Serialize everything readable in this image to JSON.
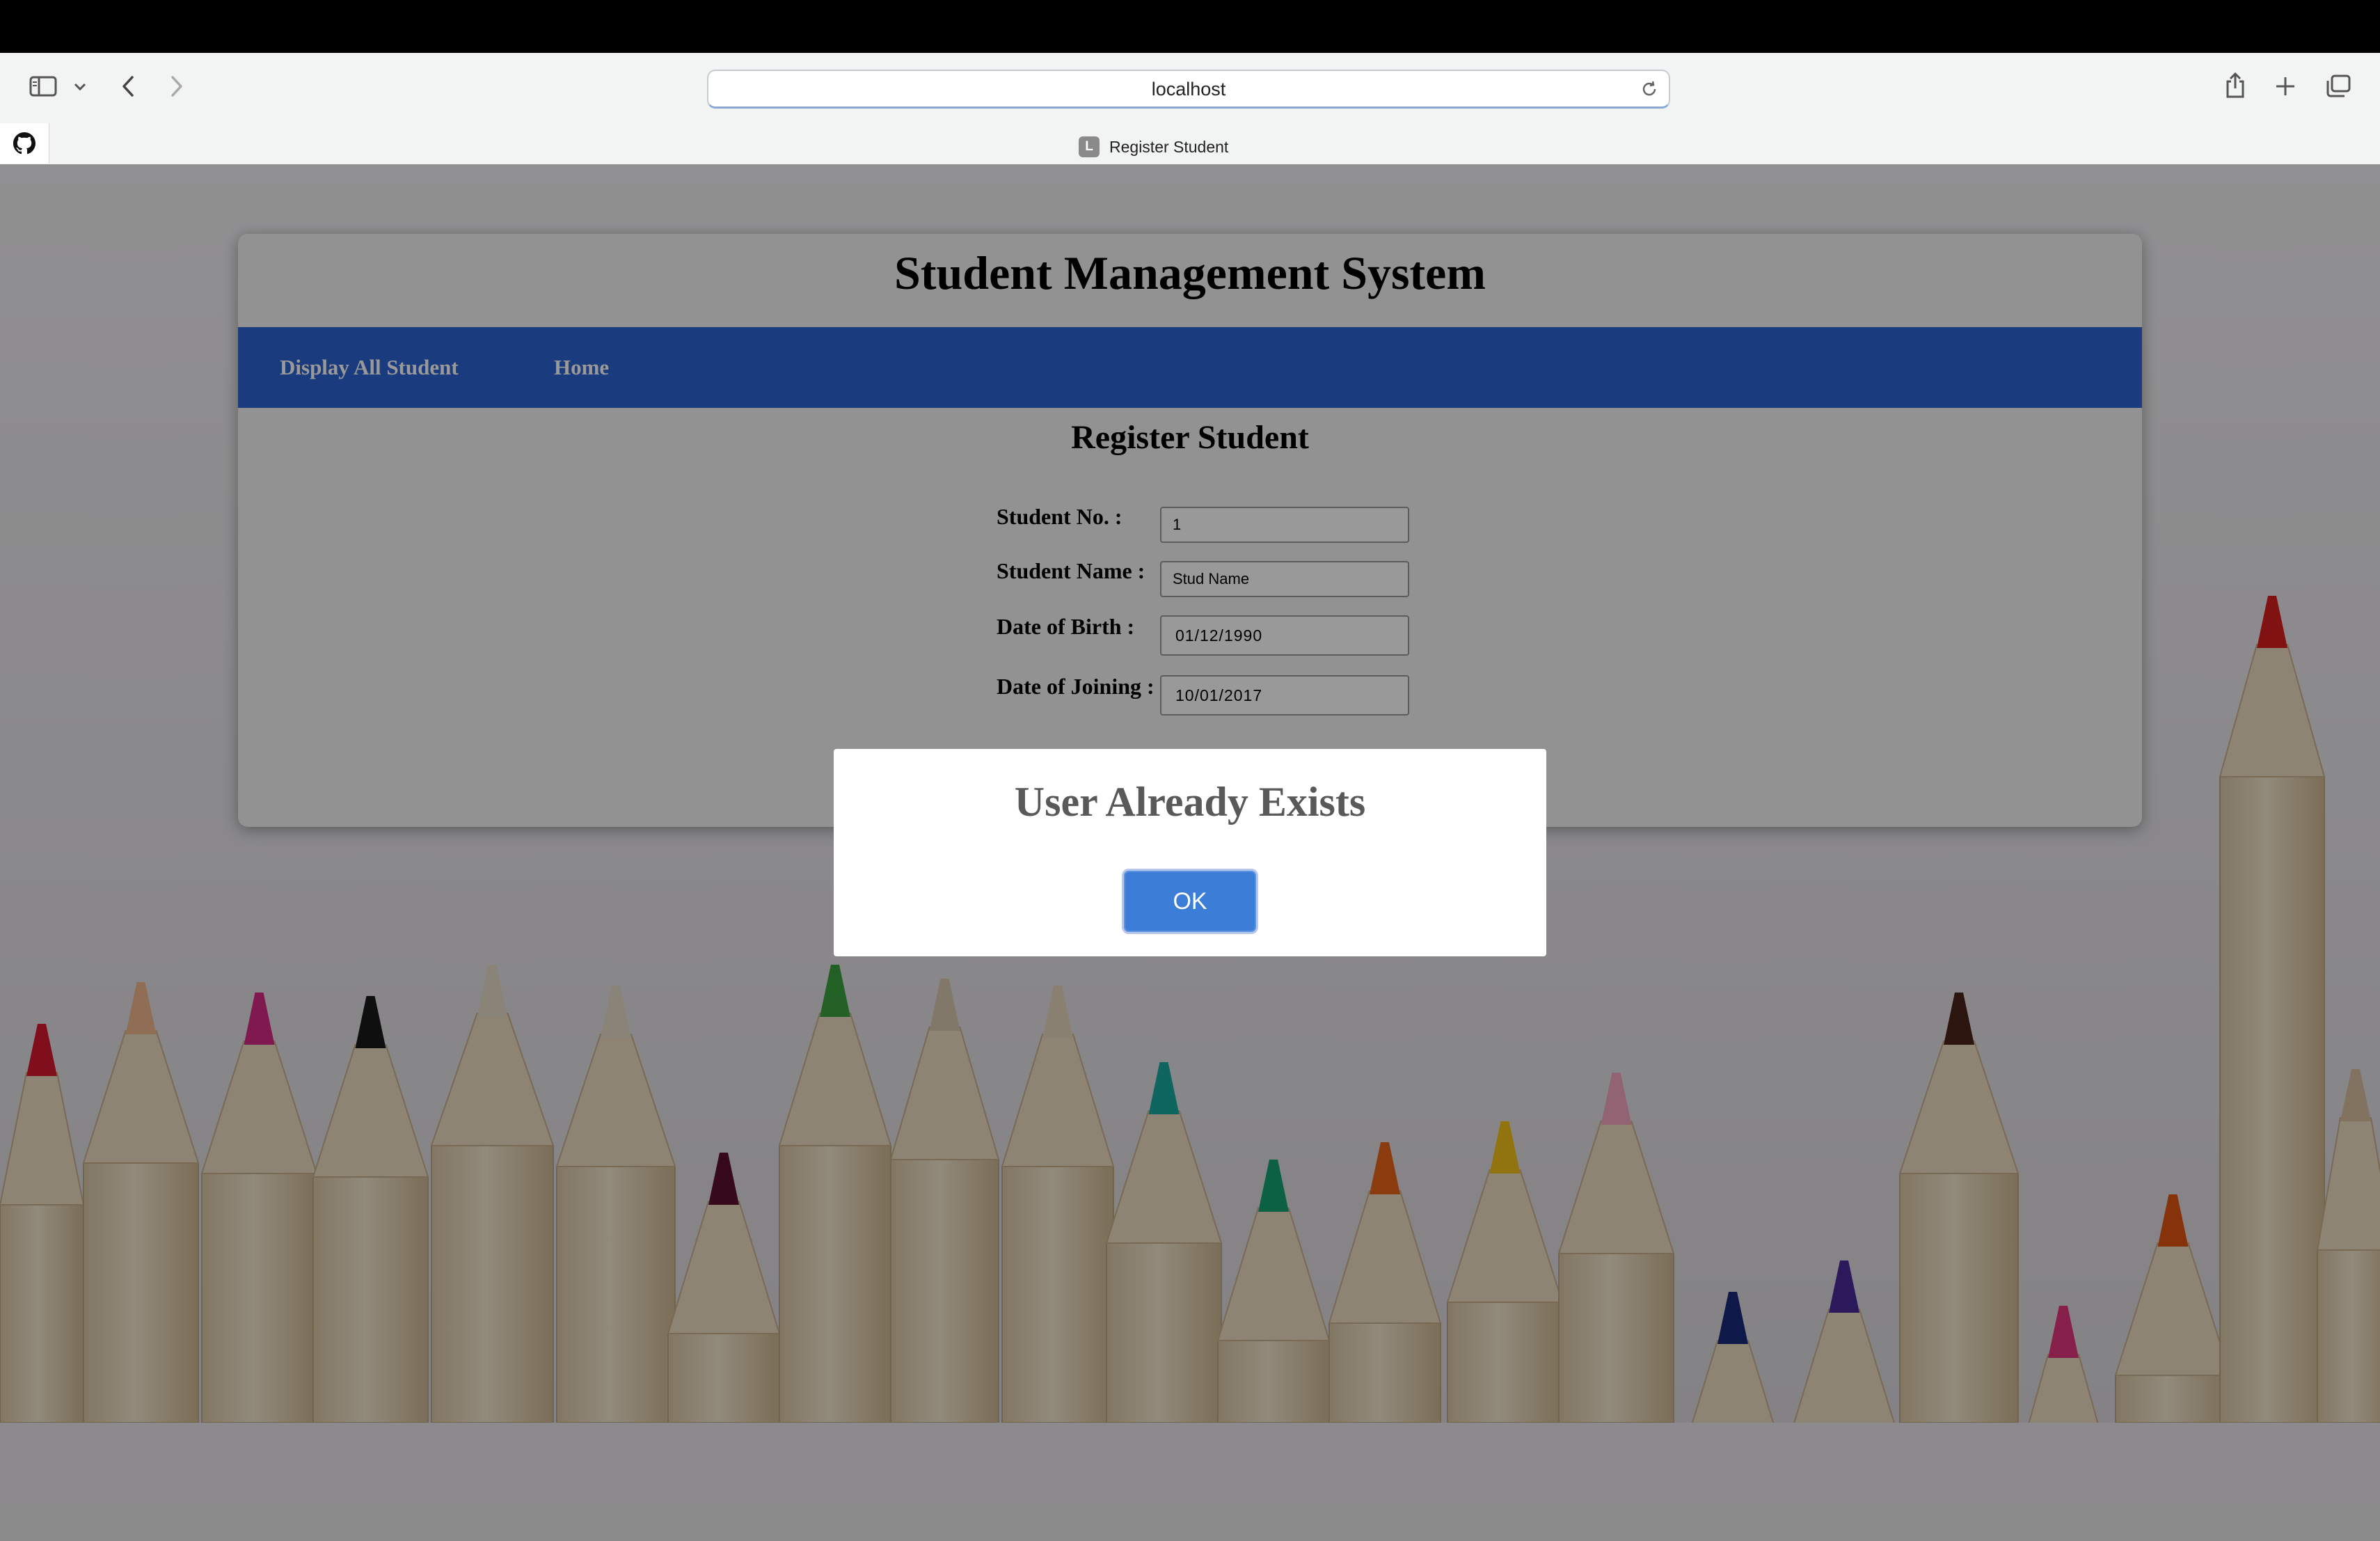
{
  "browser": {
    "url": "localhost",
    "tab_title": "Register Student",
    "tab_favicon_letter": "L",
    "icons": [
      "sidebar-icon",
      "chevron-down-icon",
      "back-icon",
      "forward-icon",
      "reload-icon",
      "share-icon",
      "new-tab-icon",
      "tab-overview-icon",
      "github-icon"
    ]
  },
  "page": {
    "site_title": "Student Management System",
    "nav": {
      "display_all": "Display All Student",
      "home": "Home"
    },
    "form": {
      "heading": "Register Student",
      "student_no_label": "Student No. :",
      "student_no_value": "1",
      "student_name_label": "Student Name :",
      "student_name_value": "Stud Name",
      "dob_label": "Date of Birth :",
      "dob_value": "01/12/1990",
      "doj_label": "Date of Joining :",
      "doj_value": "10/01/2017"
    }
  },
  "dialog": {
    "message": "User Already Exists",
    "ok_label": "OK"
  },
  "colors": {
    "nav_bar": "#2c63d1",
    "ok_button": "#3c7dd8"
  }
}
